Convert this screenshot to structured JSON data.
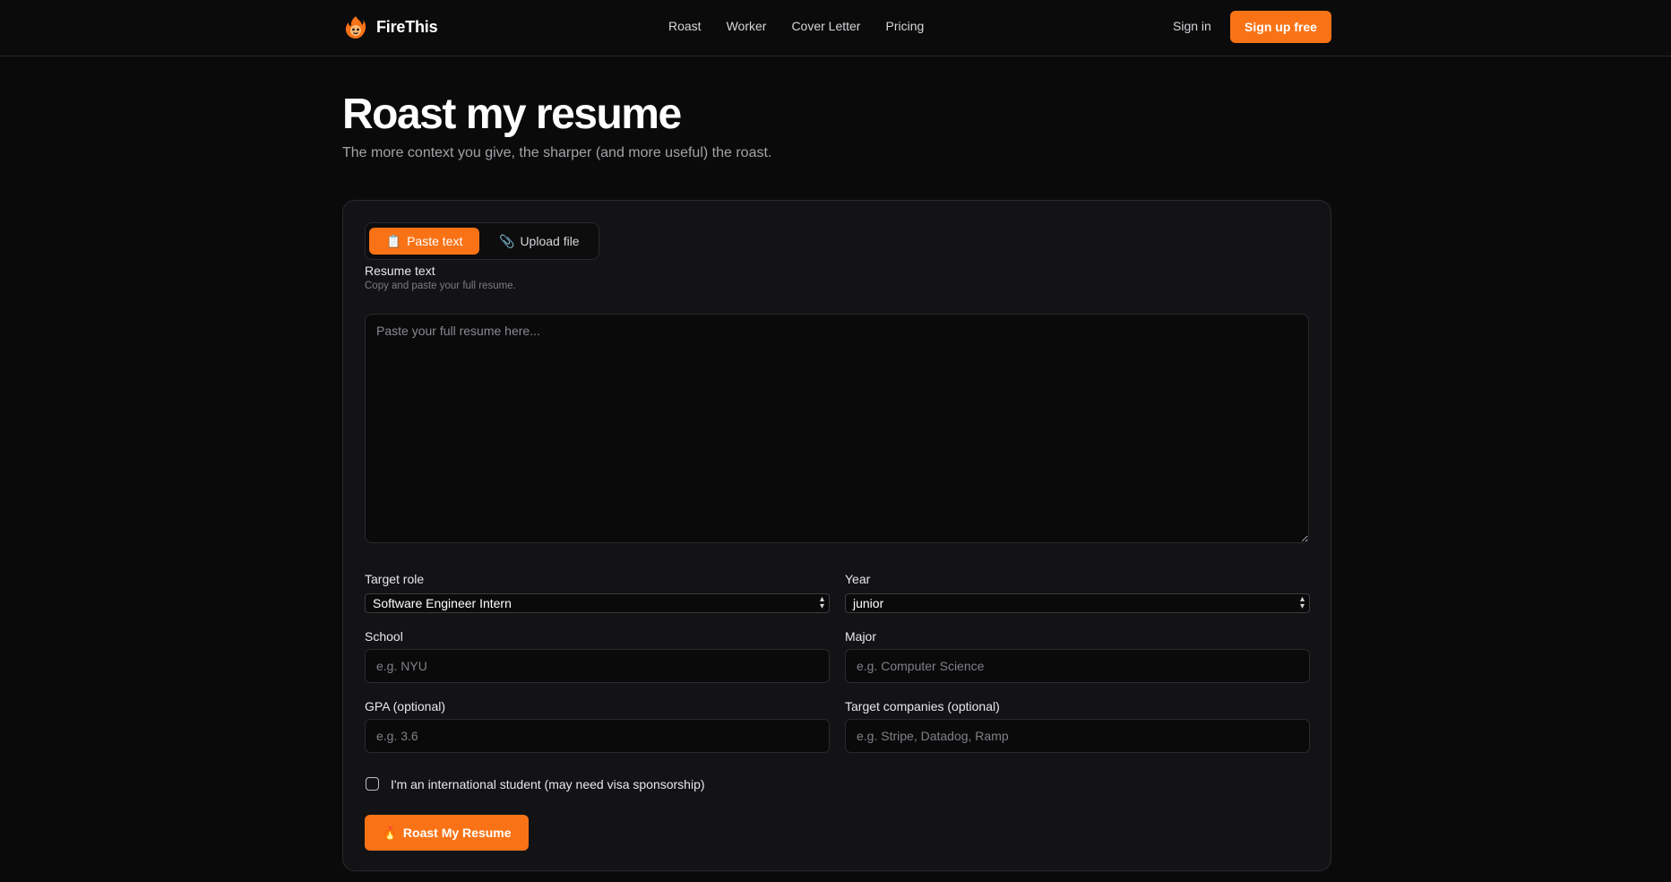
{
  "header": {
    "brand": "FireThis",
    "nav": [
      "Roast",
      "Worker",
      "Cover Letter",
      "Pricing"
    ],
    "signin": "Sign in",
    "signup": "Sign up free"
  },
  "page": {
    "title": "Roast my resume",
    "subtitle": "The more context you give, the sharper (and more useful) the roast."
  },
  "tabs": {
    "paste": {
      "icon": "📋",
      "label": "Paste text"
    },
    "upload": {
      "icon": "📎",
      "label": "Upload file"
    }
  },
  "resume": {
    "label": "Resume text",
    "hint": "Copy and paste your full resume.",
    "placeholder": "Paste your full resume here..."
  },
  "form": {
    "target_role_label": "Target role",
    "target_role_value": "Software Engineer Intern",
    "year_label": "Year",
    "year_value": "junior",
    "school_label": "School",
    "school_placeholder": "e.g. NYU",
    "major_label": "Major",
    "major_placeholder": "e.g. Computer Science",
    "gpa_label": "GPA (optional)",
    "gpa_placeholder": "e.g. 3.6",
    "companies_label": "Target companies (optional)",
    "companies_placeholder": "e.g. Stripe, Datadog, Ramp",
    "intl_label": "I'm an international student (may need visa sponsorship)",
    "submit_icon": "🔥",
    "submit_label": "Roast My Resume"
  },
  "colors": {
    "accent": "#f97316",
    "background": "#0a0a0b",
    "card": "#131315"
  }
}
